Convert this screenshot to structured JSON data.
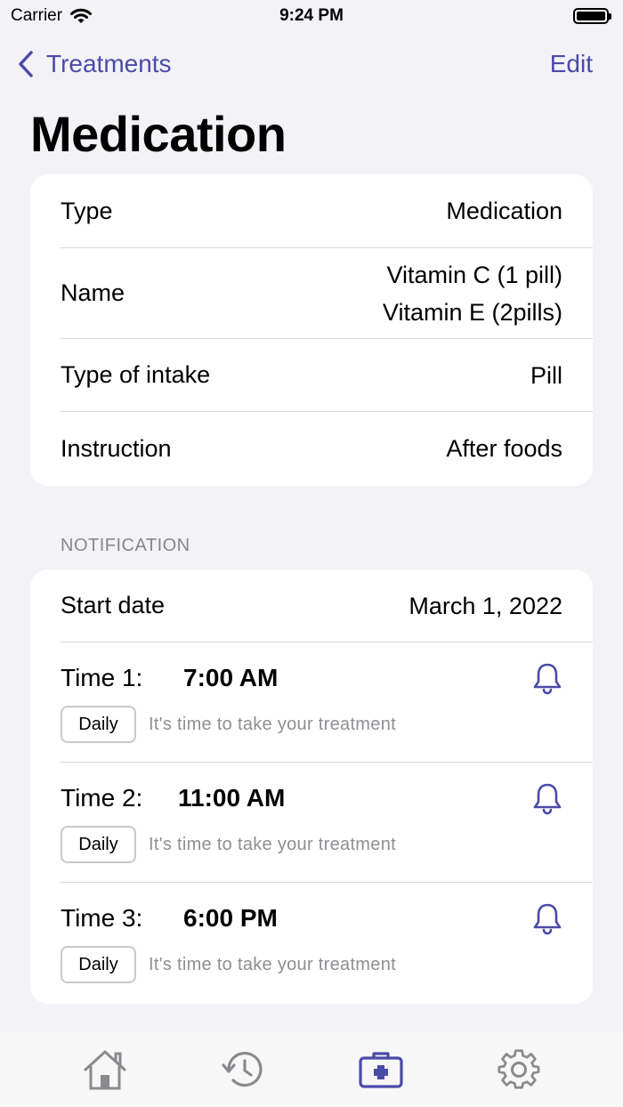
{
  "status_bar": {
    "carrier": "Carrier",
    "time": "9:24 PM"
  },
  "nav": {
    "back_label": "Treatments",
    "edit_label": "Edit"
  },
  "page": {
    "title": "Medication"
  },
  "info": {
    "type_label": "Type",
    "type_value": "Medication",
    "name_label": "Name",
    "name_values": [
      "Vitamin C (1 pill)",
      "Vitamin E (2pills)"
    ],
    "intake_label": "Type of intake",
    "intake_value": "Pill",
    "instruction_label": "Instruction",
    "instruction_value": "After foods"
  },
  "notification": {
    "header": "NOTIFICATION",
    "start_label": "Start date",
    "start_value": "March 1, 2022",
    "times": [
      {
        "label": "Time 1:",
        "value": "7:00 AM",
        "frequency": "Daily",
        "message": "It's time to take your treatment"
      },
      {
        "label": "Time 2:",
        "value": "11:00 AM",
        "frequency": "Daily",
        "message": "It's time to take your treatment"
      },
      {
        "label": "Time 3:",
        "value": "6:00 PM",
        "frequency": "Daily",
        "message": "It's time to take your treatment"
      }
    ]
  },
  "tabbar": {
    "items": [
      {
        "icon": "home-icon",
        "active": false
      },
      {
        "icon": "history-icon",
        "active": false
      },
      {
        "icon": "medical-kit-icon",
        "active": true
      },
      {
        "icon": "gear-icon",
        "active": false
      }
    ]
  },
  "colors": {
    "accent": "#4b4ba8",
    "inactive": "#8a8a8e",
    "background": "#f2f2f7"
  }
}
